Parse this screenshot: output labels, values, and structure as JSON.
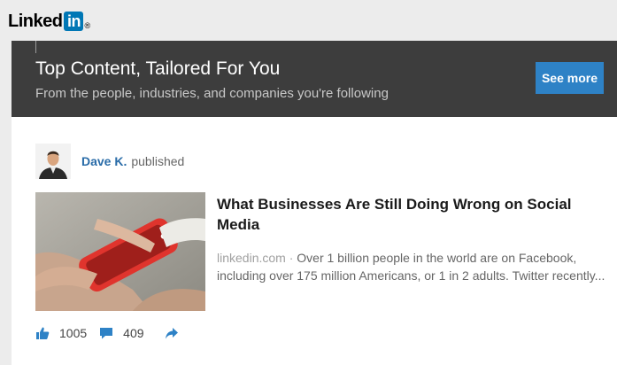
{
  "logo": {
    "word": "Linked",
    "in": "in",
    "registered": "®"
  },
  "banner": {
    "title": "Top Content, Tailored For You",
    "subtitle": "From the people, industries, and companies you're following",
    "see_more_label": "See more"
  },
  "post": {
    "author_name": "Dave K.",
    "author_action": "published",
    "article": {
      "title": "What Businesses Are Still Doing Wrong on Social Media",
      "source": "linkedin.com",
      "separator": "·",
      "snippet": "Over 1 billion people in the world are on Facebook, including over 175 million Americans, or 1 in 2 adults. Twitter recently..."
    },
    "actions": {
      "like_icon": "thumbs-up-icon",
      "like_count": "1005",
      "comment_icon": "comment-icon",
      "comment_count": "409",
      "share_icon": "share-arrow-icon"
    }
  },
  "colors": {
    "brand_blue": "#0077b5",
    "banner_bg": "#3d3d3d",
    "button_blue": "#2e82c6",
    "link_blue": "#2a6ca8"
  }
}
